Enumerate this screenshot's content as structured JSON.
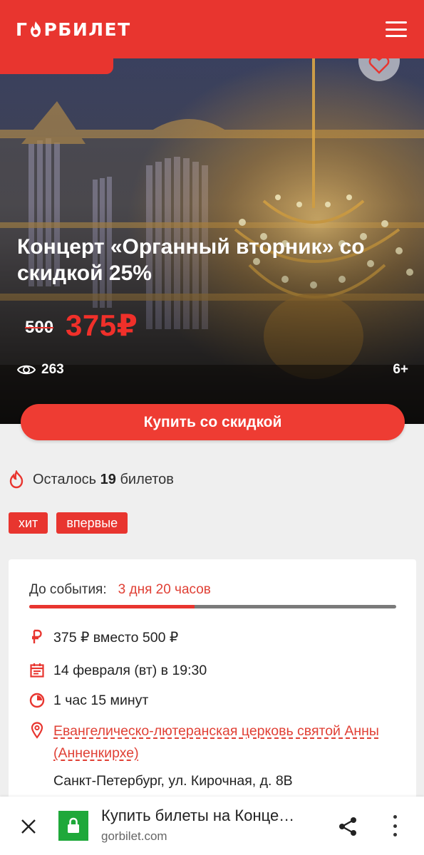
{
  "header": {
    "logo_letters": [
      "Г",
      "Р",
      "Б",
      "И",
      "Л",
      "Е",
      "Т"
    ],
    "brand_color": "#e8352f",
    "menu_icon": "hamburger-icon"
  },
  "hero": {
    "title": "Концерт «Органный вторник» со скидкой 25%",
    "old_price": "500",
    "new_price": "375₽",
    "views": "263",
    "age_rating": "6+",
    "favorite_icon": "heart-icon"
  },
  "buy_button": "Купить со скидкой",
  "remaining": {
    "prefix": "Осталось",
    "count": "19",
    "suffix": "билетов"
  },
  "tags": [
    "хит",
    "впервые"
  ],
  "event_card": {
    "countdown_label": "До события:",
    "countdown_value": "3 дня 20 часов",
    "progress_fraction": 0.45,
    "price_line": "375 ₽ вместо 500 ₽",
    "date_line": "14 февраля (вт) в 19:30",
    "duration_line": "1 час 15 минут",
    "venue": "Евангелическо-лютеранская церковь святой Анны (Анненкирхе)",
    "address": "Санкт-Петербург, ул. Кирочная, д. 8В"
  },
  "browser_bar": {
    "page_title": "Купить билеты на Конце…",
    "url": "gorbilet.com",
    "secure_color": "#1fa83a"
  }
}
